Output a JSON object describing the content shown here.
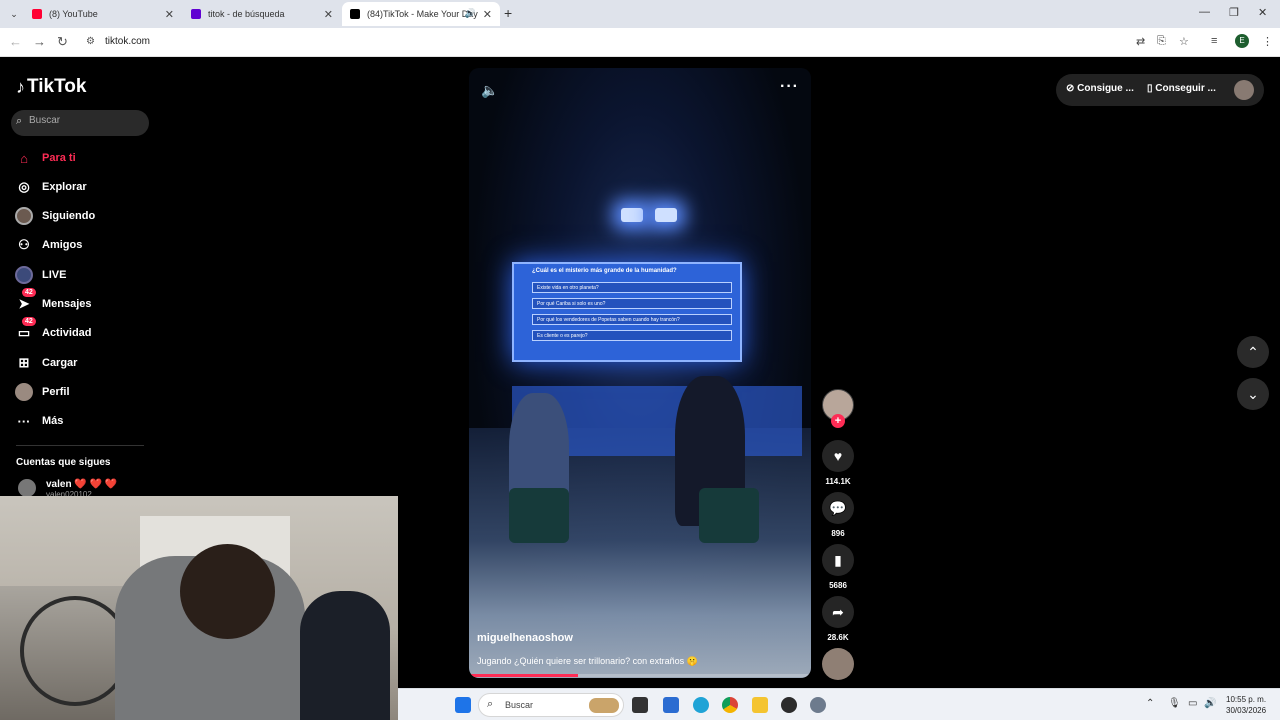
{
  "browser": {
    "tabs": [
      {
        "title": "(8) YouTube",
        "favicon_color": "#ff0033"
      },
      {
        "title": "titok - de búsqueda",
        "favicon_color": "#6001d2"
      },
      {
        "title": "(84)TikTok - Make Your Day",
        "favicon_color": "#000000"
      }
    ],
    "url": "tiktok.com",
    "profile_initial": "E"
  },
  "sidebar": {
    "logo": "TikTok",
    "search_placeholder": "Buscar",
    "items": [
      {
        "label": "Para ti",
        "icon": "home-icon",
        "active": true
      },
      {
        "label": "Explorar",
        "icon": "compass-icon"
      },
      {
        "label": "Siguiendo",
        "icon": "following-avatar-icon"
      },
      {
        "label": "Amigos",
        "icon": "friends-icon"
      },
      {
        "label": "LIVE",
        "icon": "live-icon"
      },
      {
        "label": "Mensajes",
        "icon": "messages-icon",
        "badge": "42"
      },
      {
        "label": "Actividad",
        "icon": "activity-icon",
        "badge": "42"
      },
      {
        "label": "Cargar",
        "icon": "upload-icon"
      },
      {
        "label": "Perfil",
        "icon": "profile-avatar-icon"
      },
      {
        "label": "Más",
        "icon": "more-icon"
      }
    ],
    "following_title": "Cuentas que sigues",
    "following_account": "valen ❤️ ❤️ ❤️",
    "following_handle": "valen020102"
  },
  "video": {
    "username": "miguelhenaoshow",
    "caption": "Jugando ¿Quién quiere ser trillonario? con extraños 🤫",
    "progress": 0.32,
    "screen_question": "¿Cuál es el misterio más grande de la humanidad?",
    "screen_options": [
      "Existe vida en otro planeta?",
      "Por qué Cariba si solo es uno?",
      "Por qué los vendedores de Popetas saben cuando hay trancón?",
      "Es cliente o es parejo?"
    ]
  },
  "actions": {
    "likes": "114.1K",
    "comments": "896",
    "saves": "5686",
    "shares": "28.6K"
  },
  "topbar": {
    "coins_label": "Consigue ...",
    "app_label": "Conseguir ..."
  },
  "taskbar": {
    "search_label": "Buscar",
    "time": "10:55 p. m.",
    "date": "30/03/2026"
  },
  "colors": {
    "accent": "#fe2c55",
    "background": "#000000"
  }
}
